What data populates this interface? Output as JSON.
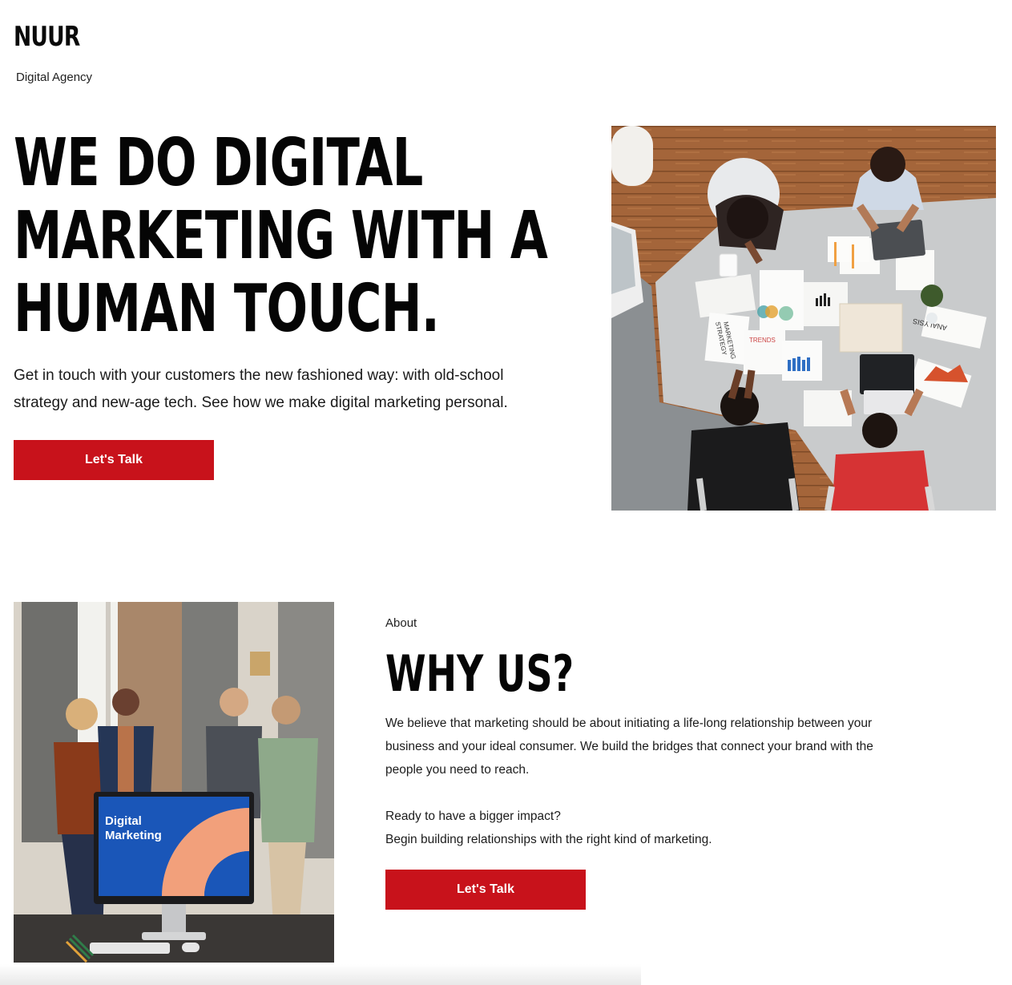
{
  "brand": {
    "name": "NUUR",
    "tagline": "Digital Agency"
  },
  "hero": {
    "title_lines": [
      "WE DO DIGITAL",
      "MARKETING WITH A",
      "HUMAN TOUCH."
    ],
    "subtitle_line1": "Get in touch with your customers the new fashioned way: with old-school",
    "subtitle_line2": "strategy and new-age tech. See how we make digital marketing personal.",
    "cta_label": "Let's Talk",
    "image_papers": {
      "marketing": "MARKETING",
      "strategy": "STRATEGY",
      "trends": "TRENDS",
      "analysis": "ANALYSIS"
    }
  },
  "about": {
    "label": "About",
    "title": "WHY US?",
    "paragraph1_line1": "We believe that marketing should be about initiating a life-long relationship between your",
    "paragraph1_line2": "business and your ideal consumer. We build the bridges that connect your brand with the",
    "paragraph1_line3": "people you need to reach.",
    "paragraph2_line1": "Ready to have a bigger impact?",
    "paragraph2_line2": "Begin building relationships with the right kind of marketing.",
    "cta_label": "Let's Talk",
    "image_screen_line1": "Digital",
    "image_screen_line2": "Marketing"
  },
  "colors": {
    "accent": "#c8121b",
    "text": "#111111",
    "background": "#ffffff"
  }
}
